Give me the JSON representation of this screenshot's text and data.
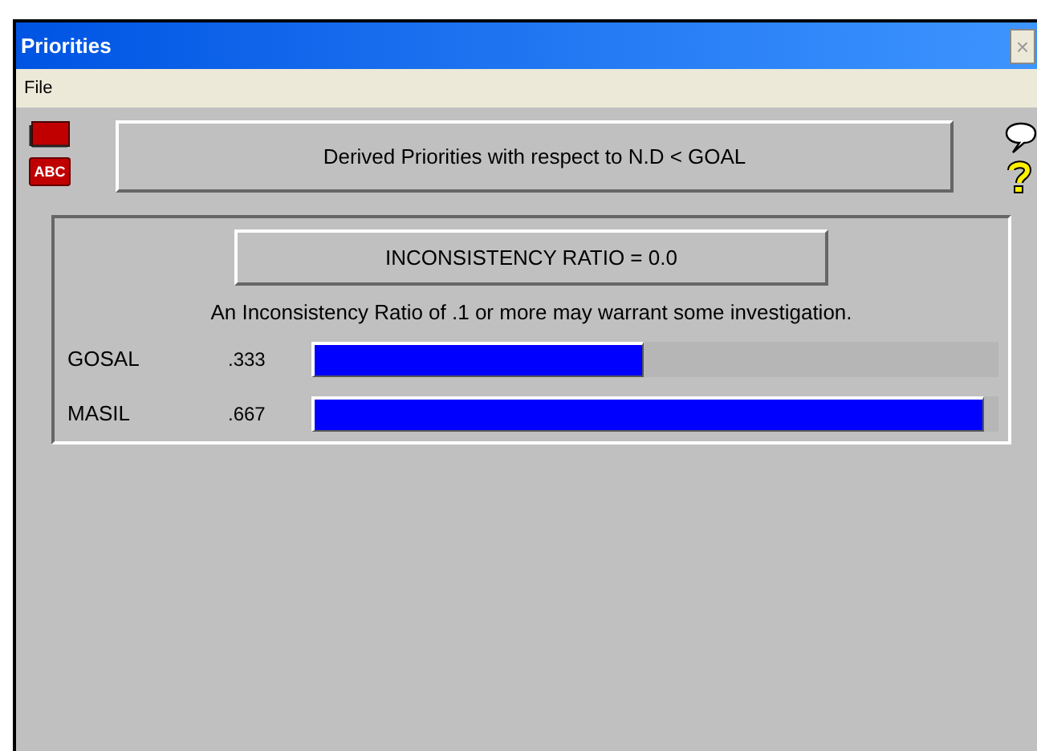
{
  "window": {
    "title": "Priorities",
    "close": "×"
  },
  "menu": [
    "File"
  ],
  "left_toolbar": {
    "abc_label": "ABC"
  },
  "heading": "Derived Priorities with respect to N.D < GOAL",
  "inconsistency": "INCONSISTENCY RATIO = 0.0",
  "note": "An Inconsistency Ratio of .1 or more may warrant some investigation.",
  "priorities": [
    {
      "name": "GOSAL",
      "value": ".333",
      "level": 0.484
    },
    {
      "name": "MASIL",
      "value": ".667",
      "level": 0.979
    }
  ]
}
